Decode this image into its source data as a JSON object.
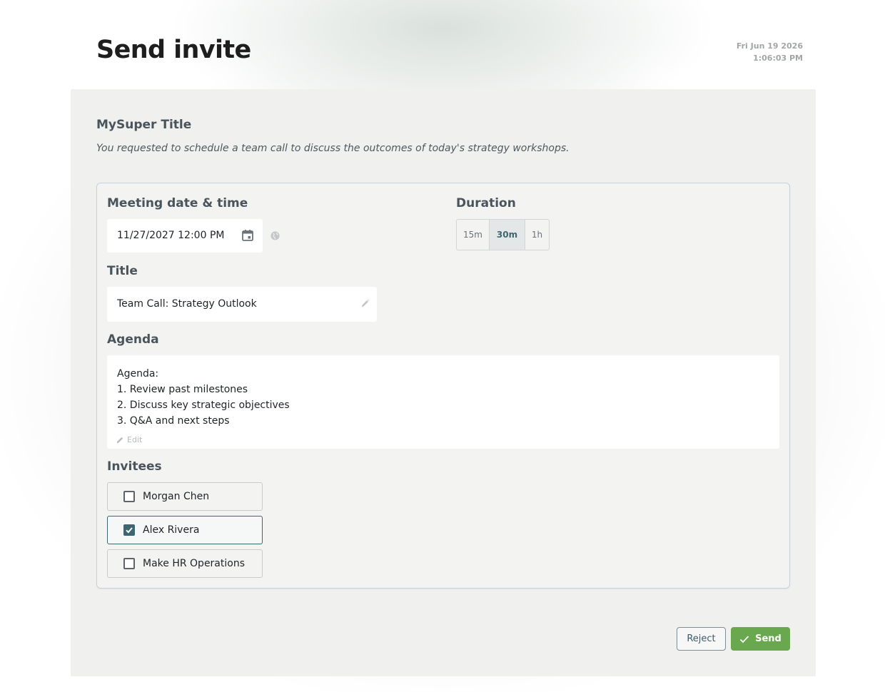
{
  "header": {
    "title": "Send invite",
    "date": "Fri Jun 19 2026",
    "time": "1:06:03 PM"
  },
  "section": {
    "title": "MySuper Title",
    "description": "You requested to schedule a team call to discuss the outcomes of today's strategy workshops."
  },
  "form": {
    "datetime_label": "Meeting date & time",
    "datetime_value": "11/27/2027 12:00 PM",
    "duration_label": "Duration",
    "durations": [
      {
        "label": "15m",
        "active": false
      },
      {
        "label": "30m",
        "active": true
      },
      {
        "label": "1h",
        "active": false
      }
    ],
    "title_label": "Title",
    "title_value": "Team Call: Strategy Outlook",
    "agenda_label": "Agenda",
    "agenda_lines": [
      "Agenda:",
      "1. Review past milestones",
      "2. Discuss key strategic objectives",
      "3. Q&A and next steps"
    ],
    "agenda_edit": "Edit",
    "invitees_label": "Invitees",
    "invitees": [
      {
        "name": "Morgan Chen",
        "checked": false
      },
      {
        "name": "Alex Rivera",
        "checked": true
      },
      {
        "name": "Make HR Operations",
        "checked": false
      }
    ]
  },
  "actions": {
    "reject": "Reject",
    "send": "Send"
  },
  "colors": {
    "accent": "#3c6770",
    "send": "#6aa84f",
    "card_bg": "#f0f0ef"
  },
  "icons": [
    "calendar-icon",
    "globe-icon",
    "pencil-icon",
    "checkmark-icon"
  ]
}
